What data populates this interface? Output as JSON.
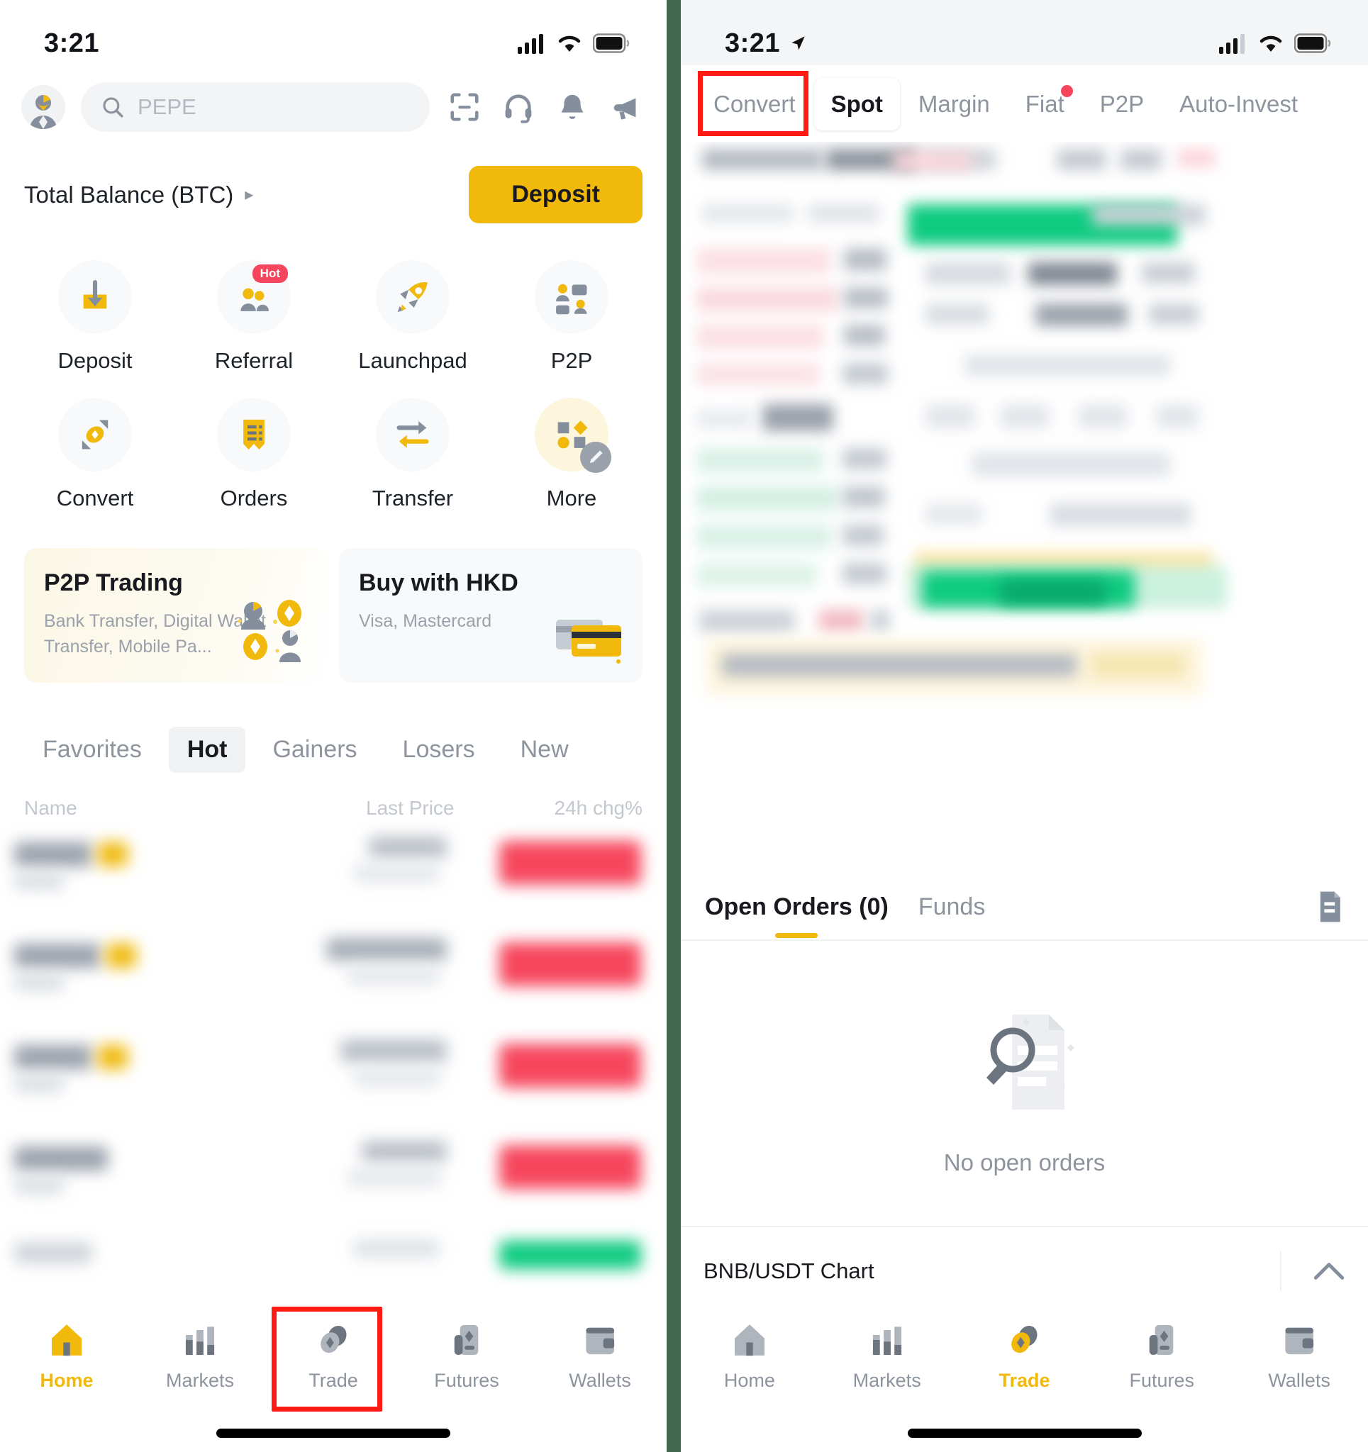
{
  "left_phone": {
    "status_bar": {
      "time": "3:21"
    },
    "header": {
      "search_placeholder": "PEPE",
      "icons": [
        "scan-icon",
        "headset-icon",
        "bell-icon",
        "announcement-icon"
      ]
    },
    "balance": {
      "label": "Total Balance (BTC)",
      "deposit_label": "Deposit"
    },
    "quick_actions": [
      {
        "label": "Deposit",
        "icon": "deposit-icon",
        "badge": ""
      },
      {
        "label": "Referral",
        "icon": "referral-icon",
        "badge": "Hot"
      },
      {
        "label": "Launchpad",
        "icon": "rocket-icon",
        "badge": ""
      },
      {
        "label": "P2P",
        "icon": "p2p-icon",
        "badge": ""
      },
      {
        "label": "Convert",
        "icon": "convert-icon",
        "badge": ""
      },
      {
        "label": "Orders",
        "icon": "orders-icon",
        "badge": ""
      },
      {
        "label": "Transfer",
        "icon": "transfer-icon",
        "badge": ""
      },
      {
        "label": "More",
        "icon": "more-icon",
        "badge": ""
      }
    ],
    "promos": [
      {
        "title": "P2P Trading",
        "subtitle": "Bank Transfer, Digital Wallet Transfer, Mobile Pa..."
      },
      {
        "title": "Buy with HKD",
        "subtitle": "Visa, Mastercard"
      }
    ],
    "market_tabs": [
      {
        "label": "Favorites",
        "active": false
      },
      {
        "label": "Hot",
        "active": true
      },
      {
        "label": "Gainers",
        "active": false
      },
      {
        "label": "Losers",
        "active": false
      },
      {
        "label": "New",
        "active": false
      }
    ],
    "market_columns": {
      "name": "Name",
      "last_price": "Last Price",
      "change": "24h chg%"
    },
    "bottom_nav": [
      {
        "label": "Home",
        "icon": "home-icon",
        "active": true,
        "highlighted": false
      },
      {
        "label": "Markets",
        "icon": "markets-icon",
        "active": false,
        "highlighted": false
      },
      {
        "label": "Trade",
        "icon": "trade-icon",
        "active": false,
        "highlighted": true
      },
      {
        "label": "Futures",
        "icon": "futures-icon",
        "active": false,
        "highlighted": false
      },
      {
        "label": "Wallets",
        "icon": "wallets-icon",
        "active": false,
        "highlighted": false
      }
    ]
  },
  "right_phone": {
    "status_bar": {
      "time": "3:21",
      "location_icon": "location-arrow-icon"
    },
    "trade_tabs": [
      {
        "label": "Convert",
        "active": false,
        "highlighted": true,
        "dot": false
      },
      {
        "label": "Spot",
        "active": true,
        "highlighted": false,
        "dot": false
      },
      {
        "label": "Margin",
        "active": false,
        "highlighted": false,
        "dot": false
      },
      {
        "label": "Fiat",
        "active": false,
        "highlighted": false,
        "dot": true
      },
      {
        "label": "P2P",
        "active": false,
        "highlighted": false,
        "dot": false
      },
      {
        "label": "Auto-Invest",
        "active": false,
        "highlighted": false,
        "dot": false
      }
    ],
    "orders_panel": {
      "tabs": [
        {
          "label": "Open Orders (0)",
          "active": true
        },
        {
          "label": "Funds",
          "active": false
        }
      ],
      "doc_icon": "order-history-icon",
      "empty_text": "No open orders",
      "empty_icon": "no-results-icon"
    },
    "chart_row": {
      "label": "BNB/USDT Chart",
      "chevron": "chevron-up-icon"
    },
    "bottom_nav": [
      {
        "label": "Home",
        "icon": "home-icon",
        "active": false
      },
      {
        "label": "Markets",
        "icon": "markets-icon",
        "active": false
      },
      {
        "label": "Trade",
        "icon": "trade-icon",
        "active": true
      },
      {
        "label": "Futures",
        "icon": "futures-icon",
        "active": false
      },
      {
        "label": "Wallets",
        "icon": "wallets-icon",
        "active": false
      }
    ]
  },
  "colors": {
    "brand_yellow": "#f0b90b",
    "highlight_red": "#ff1a14",
    "up_green": "#0ecb81",
    "down_red": "#f6465d",
    "text_primary": "#181a20",
    "text_muted": "#8d949e",
    "backdrop_green": "#44684f"
  }
}
